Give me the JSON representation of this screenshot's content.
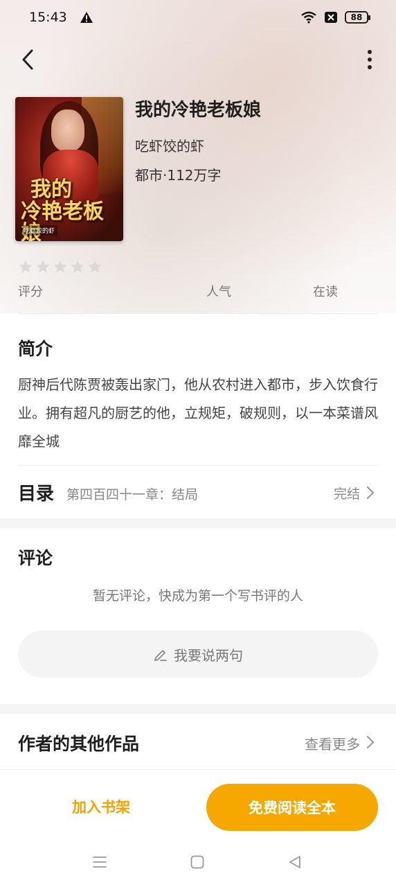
{
  "status_bar": {
    "time": "15:43",
    "battery": "88",
    "icons": [
      "warning-icon",
      "wifi-icon",
      "no-sim-icon",
      "battery-icon"
    ]
  },
  "nav": {
    "back_icon": "back-arrow-icon",
    "more_icon": "more-vertical-icon"
  },
  "book": {
    "cover_title_line1": "我的",
    "cover_title_line2": "冷艳老板娘",
    "cover_author": "吃虾饺的虾",
    "title": "我的冷艳老板娘",
    "author": "吃虾饺的虾",
    "meta": "都市·112万字"
  },
  "stats": {
    "stars_filled": 0,
    "stars_total": 5,
    "score_label": "评分",
    "popularity_label": "人气",
    "reading_label": "在读"
  },
  "intro": {
    "title": "简介",
    "text": "厨神后代陈贾被轰出家门，他从农村进入都市，步入饮食行业。拥有超凡的厨艺的他，立规矩，破规则，以一本菜谱风靡全城"
  },
  "toc": {
    "title": "目录",
    "latest_chapter": "第四百四十一章：结局",
    "status": "完结"
  },
  "comments": {
    "title": "评论",
    "empty_text": "暂无评论，快成为第一个写书评的人",
    "write_button": "我要说两句"
  },
  "other_works": {
    "title": "作者的其他作品",
    "see_more": "查看更多"
  },
  "actions": {
    "add_shelf": "加入书架",
    "read_free": "免费阅读全本"
  },
  "colors": {
    "accent": "#f6a700",
    "accent_text": "#f5a100",
    "star_empty": "#d9d9d9"
  }
}
